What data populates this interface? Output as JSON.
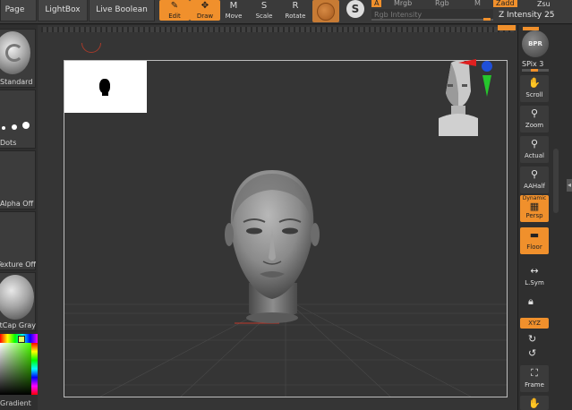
{
  "top_bar": {
    "tabs": [
      "Page",
      "LightBox",
      "Live Boolean"
    ],
    "tools": [
      {
        "label": "Edit",
        "glyph": "✎",
        "active": true
      },
      {
        "label": "Draw",
        "glyph": "✥",
        "active": true
      },
      {
        "label": "Move",
        "glyph": "M",
        "active": false
      },
      {
        "label": "Scale",
        "glyph": "S",
        "active": false
      },
      {
        "label": "Rotate",
        "glyph": "R",
        "active": false
      }
    ],
    "fields": {
      "a": "A",
      "mrgb": "Mrgb",
      "rgb": "Rgb",
      "m": "M",
      "zadd": "Zadd",
      "zsub": "Zsu"
    },
    "rgb_intensity_label": "Rgb Intensity",
    "z_intensity_label": "Z Intensity",
    "z_intensity_value": "25"
  },
  "left_tray": {
    "brush_label": "Standard",
    "stroke_label": "Dots",
    "alpha_label": "Alpha Off",
    "texture_label": "Texture Off",
    "material_label": "MatCap Gray",
    "gradient_label": "Gradient"
  },
  "right_shelf": {
    "bpr_label": "BPR",
    "spix_label": "SPix",
    "spix_value": "3",
    "buttons": [
      {
        "label": "Scroll",
        "icon": "hand-icon",
        "glyph": "✋",
        "active": false
      },
      {
        "label": "Zoom",
        "icon": "zoom-icon",
        "glyph": "🔍",
        "active": false
      },
      {
        "label": "Actual",
        "icon": "actual-icon",
        "glyph": "🔍",
        "active": false
      },
      {
        "label": "AAHalf",
        "icon": "aahalf-icon",
        "glyph": "🔍",
        "active": false
      },
      {
        "label": "Persp",
        "icon": "persp-icon",
        "glyph": "▦",
        "active": true,
        "top_label": "Dynamic"
      },
      {
        "label": "Floor",
        "icon": "floor-icon",
        "glyph": "▬",
        "active": true
      },
      {
        "label": "L.Sym",
        "icon": "lsym-icon",
        "glyph": "↔",
        "active": false
      }
    ],
    "lock_icon": "lock-icon",
    "xyz_label": "XYZ",
    "frame_label": "Frame"
  },
  "colors": {
    "accent": "#f0902c",
    "bg": "#2b2b2b",
    "panel": "#3a3a3a"
  }
}
